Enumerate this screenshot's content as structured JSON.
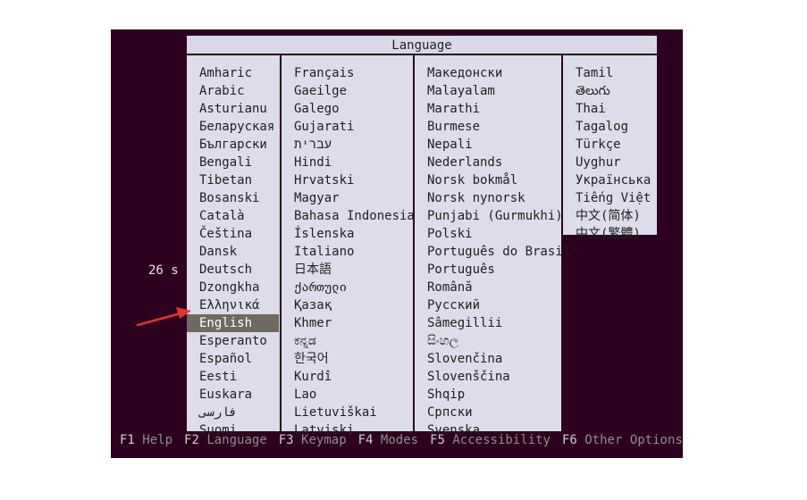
{
  "title": "Language",
  "countdown": "26 s",
  "columns": [
    [
      "Amharic",
      "Arabic",
      "Asturianu",
      "Беларуская",
      "Български",
      "Bengali",
      "Tibetan",
      "Bosanski",
      "Català",
      "Čeština",
      "Dansk",
      "Deutsch",
      "Dzongkha",
      "Ελληνικά",
      "English",
      "Esperanto",
      "Español",
      "Eesti",
      "Euskara",
      "فارسی",
      "Suomi"
    ],
    [
      "Français",
      "Gaeilge",
      "Galego",
      "Gujarati",
      "עברית",
      "Hindi",
      "Hrvatski",
      "Magyar",
      "Bahasa Indonesia",
      "Íslenska",
      "Italiano",
      "日本語",
      "ქართული",
      "Қазақ",
      "Khmer",
      "ಕನ್ನಡ",
      "한국어",
      "Kurdî",
      "Lao",
      "Lietuviškai",
      "Latviski"
    ],
    [
      "Македонски",
      "Malayalam",
      "Marathi",
      "Burmese",
      "Nepali",
      "Nederlands",
      "Norsk bokmål",
      "Norsk nynorsk",
      "Punjabi (Gurmukhi)",
      "Polski",
      "Português do Brasil",
      "Português",
      "Română",
      "Русский",
      "Sâmegillii",
      "සිංහල",
      "Slovenčina",
      "Slovenščina",
      "Shqip",
      "Српски",
      "Svenska"
    ],
    [
      "Tamil",
      "తెలుగు",
      "Thai",
      "Tagalog",
      "Türkçe",
      "Uyghur",
      "Українська",
      "Tiếng Việt",
      "中文(简体)",
      "中文(繁體)"
    ]
  ],
  "selected": "English",
  "footer": [
    {
      "key": "F1",
      "label": "Help"
    },
    {
      "key": "F2",
      "label": "Language"
    },
    {
      "key": "F3",
      "label": "Keymap"
    },
    {
      "key": "F4",
      "label": "Modes"
    },
    {
      "key": "F5",
      "label": "Accessibility"
    },
    {
      "key": "F6",
      "label": "Other Options"
    }
  ],
  "colors": {
    "background": "#2c001e",
    "dialog": "#dcdceb",
    "selection": "#6e6a62",
    "annotation_arrow": "#e8322a"
  },
  "icons": {
    "pointer": "red-arrow-icon"
  }
}
